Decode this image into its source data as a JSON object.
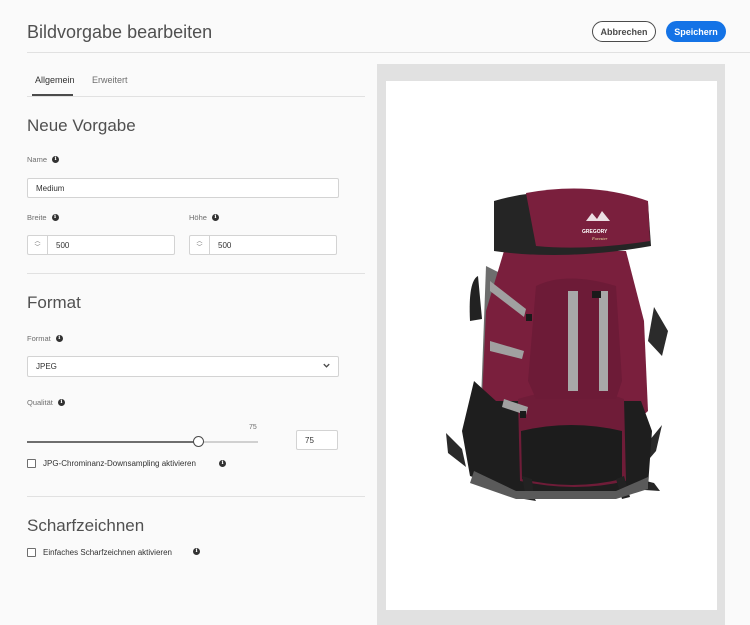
{
  "header": {
    "title": "Bildvorgabe bearbeiten",
    "cancel_label": "Abbrechen",
    "save_label": "Speichern"
  },
  "tabs": [
    {
      "label": "Allgemein",
      "active": true
    },
    {
      "label": "Erweitert",
      "active": false
    }
  ],
  "general": {
    "section_title": "Neue Vorgabe",
    "name_label": "Name",
    "name_value": "Medium",
    "width_label": "Breite",
    "width_value": "500",
    "height_label": "Höhe",
    "height_value": "500"
  },
  "format": {
    "section_title": "Format",
    "format_label": "Format",
    "format_value": "JPEG",
    "quality_label": "Qualität",
    "quality_value": "75",
    "quality_slider_value": 75,
    "quality_slider_fraction": 0.74,
    "chroma_label": "JPG-Chrominanz-Downsampling aktivieren"
  },
  "sharpen": {
    "section_title": "Scharfzeichnen",
    "simple_label": "Einfaches Scharfzeichnen aktivieren"
  },
  "colors": {
    "accent": "#1473e6",
    "pack_burgundy": "#7a1f3d",
    "pack_black": "#1e1e1e",
    "pack_grey": "#707070"
  },
  "icons": {
    "info": "info-icon",
    "stepper": "stepper-arrows-icon",
    "chevron": "chevron-down-icon"
  }
}
